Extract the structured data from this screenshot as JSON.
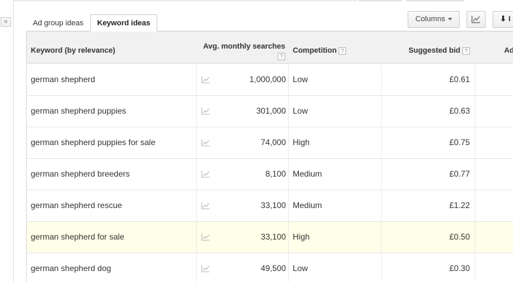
{
  "collapse": {
    "label": "«"
  },
  "tabs": [
    {
      "label": "Ad group ideas",
      "active": false
    },
    {
      "label": "Keyword ideas",
      "active": true
    }
  ],
  "toolbar": {
    "columns_label": "Columns",
    "chart_icon": "line-chart-icon",
    "download_icon": "download-icon",
    "download_label": "⬇ I"
  },
  "table": {
    "headers": {
      "keyword": "Keyword (by relevance)",
      "volume": "Avg. monthly searches",
      "competition": "Competition",
      "bid": "Suggested bid",
      "ad": "Ad",
      "help": "?"
    },
    "rows": [
      {
        "keyword": "german shepherd",
        "volume": "1,000,000",
        "competition": "Low",
        "bid": "£0.61"
      },
      {
        "keyword": "german shepherd puppies",
        "volume": "301,000",
        "competition": "Low",
        "bid": "£0.63"
      },
      {
        "keyword": "german shepherd puppies for sale",
        "volume": "74,000",
        "competition": "High",
        "bid": "£0.75"
      },
      {
        "keyword": "german shepherd breeders",
        "volume": "8,100",
        "competition": "Medium",
        "bid": "£0.77"
      },
      {
        "keyword": "german shepherd rescue",
        "volume": "33,100",
        "competition": "Medium",
        "bid": "£1.22"
      },
      {
        "keyword": "german shepherd for sale",
        "volume": "33,100",
        "competition": "High",
        "bid": "£0.50"
      },
      {
        "keyword": "german shepherd dog",
        "volume": "49,500",
        "competition": "Low",
        "bid": "£0.30"
      }
    ]
  },
  "colors": {
    "highlight_row": "#fefee9",
    "header_bg": "#f1f1f1"
  }
}
